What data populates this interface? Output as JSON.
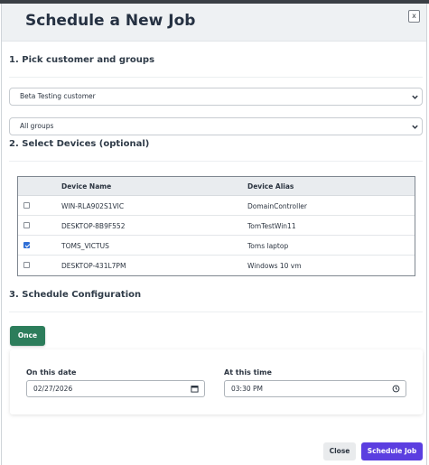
{
  "modal": {
    "title": "Schedule a New Job",
    "close_icon_label": "x"
  },
  "section1": {
    "title": "1. Pick customer and groups",
    "customer_select": "Beta Testing customer",
    "group_select": "All groups"
  },
  "section2": {
    "title": "2. Select Devices (optional)",
    "columns": [
      "Device Name",
      "Device Alias"
    ],
    "rows": [
      {
        "name": "WIN-RLA902S1VIC",
        "alias": "DomainController",
        "checked": false
      },
      {
        "name": "DESKTOP-8B9F552",
        "alias": "TomTestWin11",
        "checked": false
      },
      {
        "name": "TOMS_VICTUS",
        "alias": "Toms laptop",
        "checked": true
      },
      {
        "name": "DESKTOP-431L7PM",
        "alias": "Windows 10 vm",
        "checked": false
      }
    ]
  },
  "section3": {
    "title": "3. Schedule Configuration",
    "once_label": "Once",
    "date_label": "On this date",
    "date_value": "02/27/2026",
    "time_label": "At this time",
    "time_value": "03:30 PM"
  },
  "footer": {
    "close_label": "Close",
    "submit_label": "Schedule Job"
  },
  "colors": {
    "once_button": "#2c7d5b",
    "submit_button": "#5b3ee0",
    "checkbox_checked": "#2f6fd6"
  },
  "icons": {
    "select_chevron": "chevron-down-icon",
    "date_field": "calendar-icon",
    "time_field": "clock-icon"
  }
}
